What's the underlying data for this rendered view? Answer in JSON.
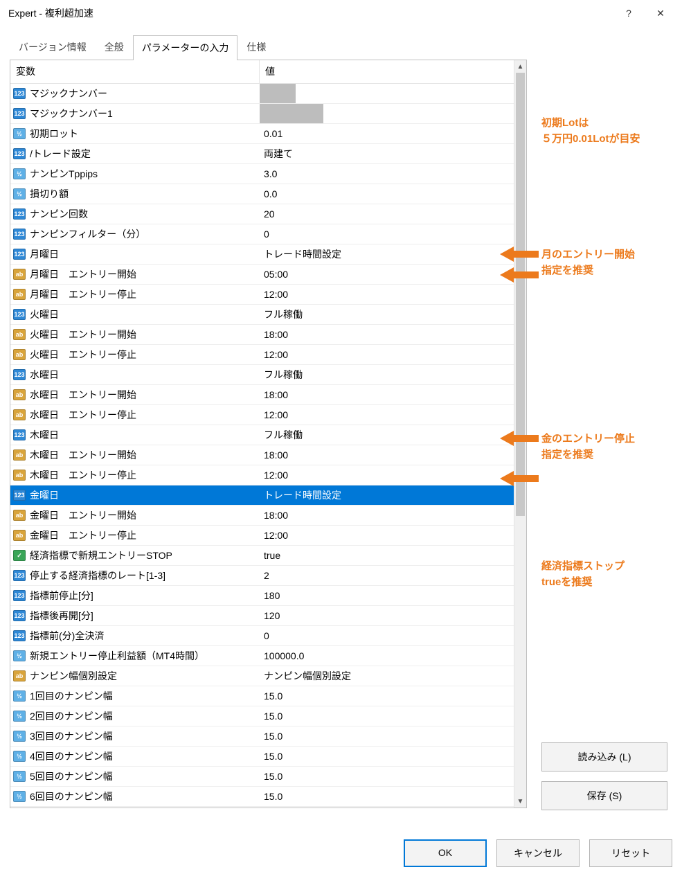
{
  "window": {
    "title": "Expert - 複利超加速",
    "help": "?",
    "close": "✕"
  },
  "tabs": [
    {
      "label": "バージョン情報"
    },
    {
      "label": "全般"
    },
    {
      "label": "パラメーターの入力",
      "active": true
    },
    {
      "label": "仕様"
    }
  ],
  "headers": {
    "variable": "変数",
    "value": "値"
  },
  "rows": [
    {
      "type": "int",
      "name": "マジックナンバー",
      "value": "",
      "mask": "short"
    },
    {
      "type": "int",
      "name": "マジックナンバー1",
      "value": "",
      "mask": "long"
    },
    {
      "type": "dbl",
      "name": "初期ロット",
      "value": "0.01"
    },
    {
      "type": "int",
      "name": "/トレード設定",
      "value": "両建て"
    },
    {
      "type": "dbl",
      "name": "ナンピンTppips",
      "value": "3.0"
    },
    {
      "type": "dbl",
      "name": "損切り額",
      "value": "0.0"
    },
    {
      "type": "int",
      "name": "ナンピン回数",
      "value": "20"
    },
    {
      "type": "int",
      "name": "ナンピンフィルター（分）",
      "value": "0"
    },
    {
      "type": "int",
      "name": "月曜日",
      "value": "トレード時間設定"
    },
    {
      "type": "str",
      "name": "月曜日　エントリー開始",
      "value": "05:00"
    },
    {
      "type": "str",
      "name": "月曜日　エントリー停止",
      "value": "12:00"
    },
    {
      "type": "int",
      "name": "火曜日",
      "value": "フル稼働"
    },
    {
      "type": "str",
      "name": "火曜日　エントリー開始",
      "value": "18:00"
    },
    {
      "type": "str",
      "name": "火曜日　エントリー停止",
      "value": "12:00"
    },
    {
      "type": "int",
      "name": "水曜日",
      "value": "フル稼働"
    },
    {
      "type": "str",
      "name": "水曜日　エントリー開始",
      "value": "18:00"
    },
    {
      "type": "str",
      "name": "水曜日　エントリー停止",
      "value": "12:00"
    },
    {
      "type": "int",
      "name": "木曜日",
      "value": "フル稼働"
    },
    {
      "type": "str",
      "name": "木曜日　エントリー開始",
      "value": "18:00"
    },
    {
      "type": "str",
      "name": "木曜日　エントリー停止",
      "value": "12:00"
    },
    {
      "type": "int",
      "name": "金曜日",
      "value": "トレード時間設定",
      "selected": true
    },
    {
      "type": "str",
      "name": "金曜日　エントリー開始",
      "value": "18:00"
    },
    {
      "type": "str",
      "name": "金曜日　エントリー停止",
      "value": "12:00"
    },
    {
      "type": "bool",
      "name": "経済指標で新規エントリーSTOP",
      "value": "true"
    },
    {
      "type": "int",
      "name": "停止する経済指標のレート[1-3]",
      "value": "2"
    },
    {
      "type": "int",
      "name": "指標前停止[分]",
      "value": "180"
    },
    {
      "type": "int",
      "name": "指標後再開[分]",
      "value": "120"
    },
    {
      "type": "int",
      "name": "指標前(分)全決済",
      "value": "0"
    },
    {
      "type": "dbl",
      "name": "新規エントリー停止利益額（MT4時間）",
      "value": "100000.0"
    },
    {
      "type": "str",
      "name": "ナンピン幅個別設定",
      "value": "ナンピン幅個別設定"
    },
    {
      "type": "dbl",
      "name": "1回目のナンピン幅",
      "value": "15.0"
    },
    {
      "type": "dbl",
      "name": "2回目のナンピン幅",
      "value": "15.0"
    },
    {
      "type": "dbl",
      "name": "3回目のナンピン幅",
      "value": "15.0"
    },
    {
      "type": "dbl",
      "name": "4回目のナンピン幅",
      "value": "15.0"
    },
    {
      "type": "dbl",
      "name": "5回目のナンピン幅",
      "value": "15.0"
    },
    {
      "type": "dbl",
      "name": "6回目のナンピン幅",
      "value": "15.0"
    }
  ],
  "annotations": {
    "a1_line1": "初期Lotは",
    "a1_line2": "５万円0.01Lotが目安",
    "a2_line1": "月のエントリー開始",
    "a2_line2": "指定を推奨",
    "a3_line1": "金のエントリー停止",
    "a3_line2": "指定を推奨",
    "a4_line1": "経済指標ストップ",
    "a4_line2": "trueを推奨"
  },
  "buttons": {
    "load": "読み込み (L)",
    "save": "保存 (S)",
    "ok": "OK",
    "cancel": "キャンセル",
    "reset": "リセット"
  },
  "icon_labels": {
    "int": "123",
    "dbl": "½",
    "str": "ab",
    "bool": "✓"
  }
}
